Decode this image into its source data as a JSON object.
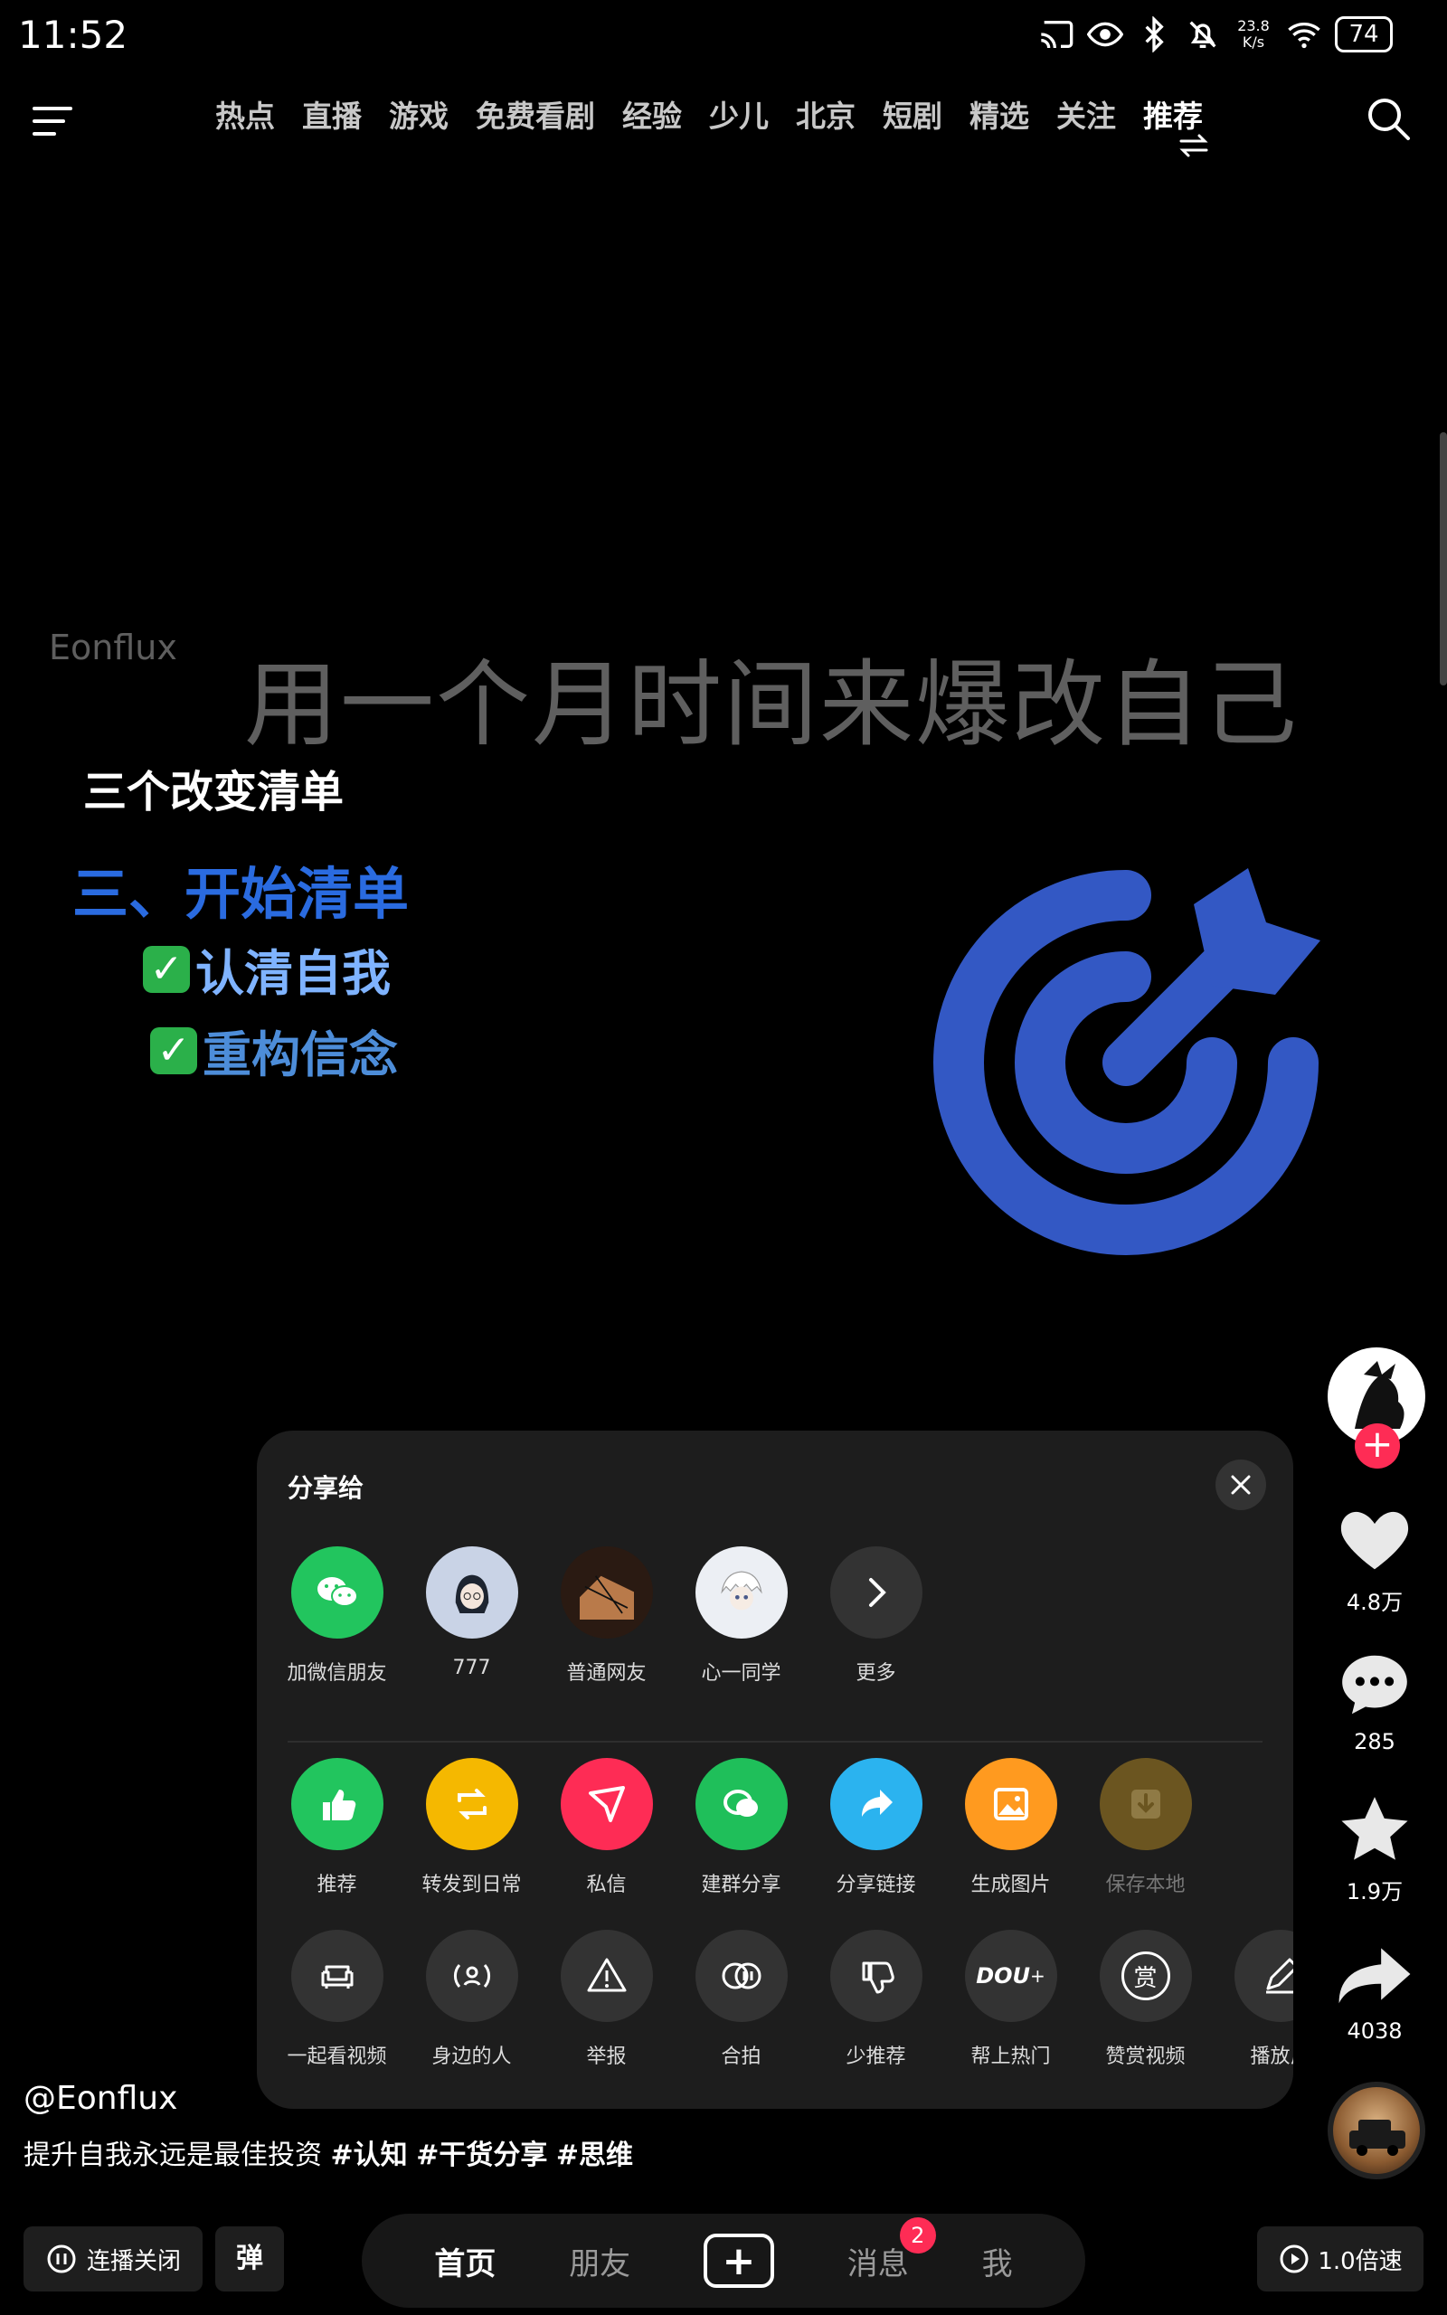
{
  "status_bar": {
    "time": "11:52",
    "net_speed_value": "23.8",
    "net_speed_unit": "K/s",
    "battery": "74"
  },
  "top_nav": {
    "tabs": [
      "热点",
      "直播",
      "游戏",
      "免费看剧",
      "经验",
      "少儿",
      "北京",
      "短剧",
      "精选",
      "关注",
      "推荐"
    ],
    "active_tab": "推荐"
  },
  "video": {
    "watermark": "Eonflux",
    "title": "用一个月时间来爆改自己",
    "list_heading": "三个改变清单",
    "list_subheading": "三、开始清单",
    "items": [
      "认清自我",
      "重构信念"
    ],
    "check_mark": "✓"
  },
  "rail": {
    "likes": "4.8万",
    "comments": "285",
    "favorites": "1.9万",
    "shares": "4038"
  },
  "share_panel": {
    "title": "分享给",
    "contacts": [
      {
        "label": "加微信朋友"
      },
      {
        "label": "777"
      },
      {
        "label": "普通网友"
      },
      {
        "label": "心一同学"
      },
      {
        "label": "更多"
      }
    ],
    "actions": [
      {
        "label": "推荐",
        "color": "#22c55e"
      },
      {
        "label": "转发到日常",
        "color": "#f5b800"
      },
      {
        "label": "私信",
        "color": "#fe2c55"
      },
      {
        "label": "建群分享",
        "color": "#1fbf5a"
      },
      {
        "label": "分享链接",
        "color": "#2bb3ef"
      },
      {
        "label": "生成图片",
        "color": "#ff9a1f"
      },
      {
        "label": "保存本地",
        "color": "#6b5520"
      }
    ],
    "tools": [
      {
        "label": "一起看视频"
      },
      {
        "label": "身边的人"
      },
      {
        "label": "举报"
      },
      {
        "label": "合拍"
      },
      {
        "label": "少推荐"
      },
      {
        "label": "帮上热门"
      },
      {
        "label": "赞赏视频"
      },
      {
        "label": "播放反"
      }
    ],
    "douplus_text": "DOU",
    "reward_text": "赏"
  },
  "caption": {
    "author": "@Eonflux",
    "text": "提升自我永远是最佳投资",
    "tags": [
      "#认知",
      "#干货分享",
      "#思维"
    ]
  },
  "bottom_bar": {
    "autoplay_label": "连播关闭",
    "danmaku_label": "弹",
    "tabs": [
      "首页",
      "朋友",
      "消息",
      "我"
    ],
    "create_label": "+",
    "messages_badge": "2",
    "speed_label": "1.0倍速"
  },
  "colors": {
    "accent": "#fe2c55",
    "target_blue": "#3358c4"
  }
}
